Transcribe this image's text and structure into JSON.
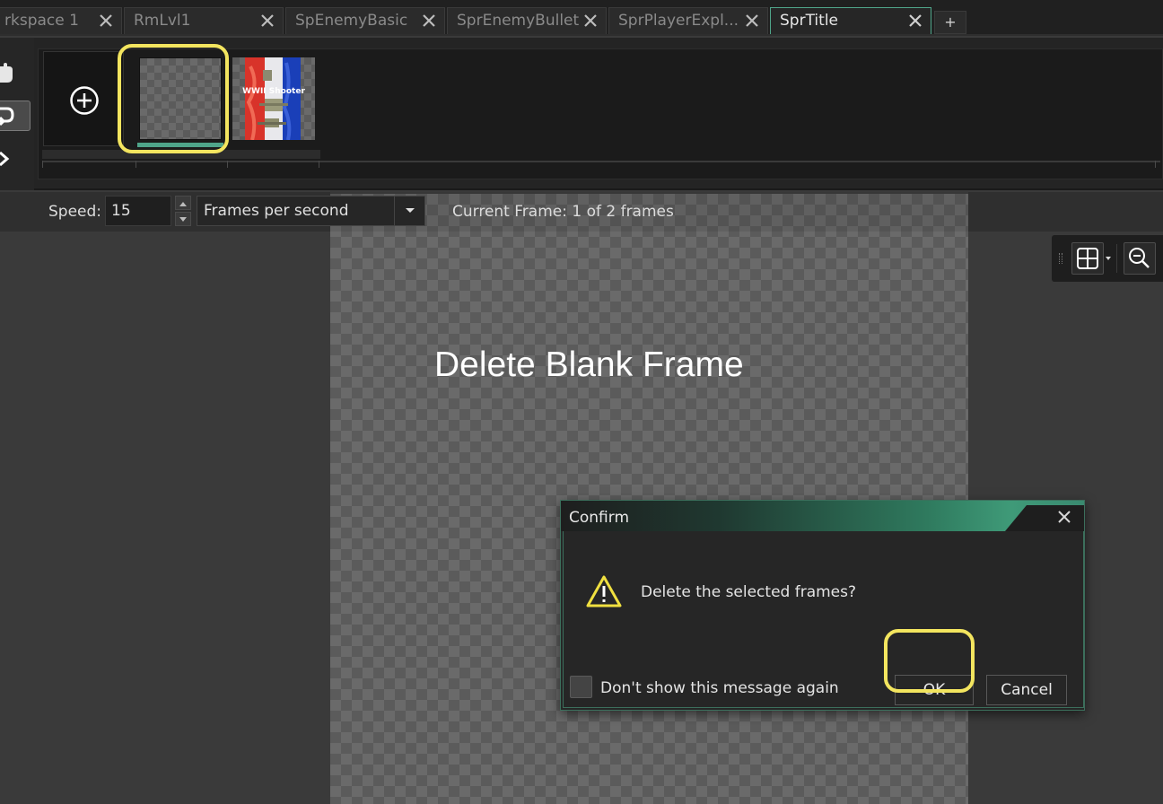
{
  "tabs": [
    {
      "label": "rkspace 1"
    },
    {
      "label": "RmLvl1"
    },
    {
      "label": "SpEnemyBasic"
    },
    {
      "label": "SprEnemyBullet"
    },
    {
      "label": "SprPlayerExpl..."
    },
    {
      "label": "SprTitle"
    }
  ],
  "tab_add_label": "+",
  "frames": {
    "thumb_caption": "WWII Shooter",
    "total": 2
  },
  "speedbar": {
    "speed_label": "Speed:",
    "speed_value": "15",
    "unit": "Frames per second",
    "current_frame": "Current Frame: 1 of 2 frames"
  },
  "annotation": "Delete Blank Frame",
  "dialog": {
    "title": "Confirm",
    "message": "Delete the selected frames?",
    "ok_label": "OK",
    "cancel_label": "Cancel",
    "dont_show_label": "Don't show this message again"
  },
  "colors": {
    "accent": "#4fa58a",
    "highlight": "#f3e55f"
  }
}
